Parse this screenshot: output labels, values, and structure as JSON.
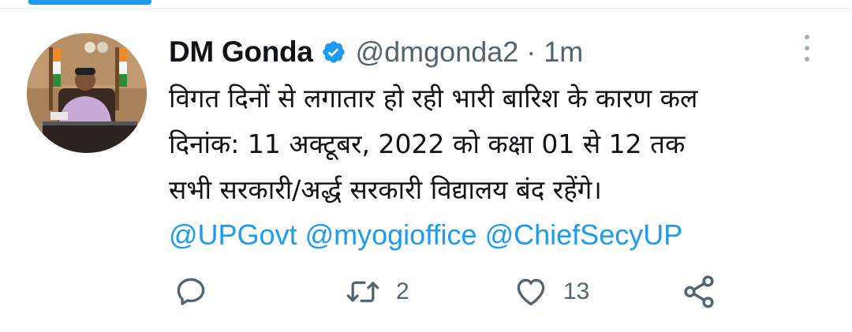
{
  "tweet": {
    "author": {
      "display_name": "DM Gonda",
      "handle": "@dmgonda2",
      "verified": true
    },
    "separator": "·",
    "time": "1m",
    "text_lines": [
      "विगत दिनों से लगातार हो रही भारी बारिश के कारण कल",
      "दिनांक: 11 अक्टूबर, 2022 को कक्षा 01 से 12 तक",
      "सभी सरकारी/अर्द्ध सरकारी विद्यालय बंद रहेंगे।"
    ],
    "mentions": [
      "@UPGovt",
      "@myogioffice",
      "@ChiefSecyUP"
    ],
    "actions": {
      "reply": {
        "icon": "reply-icon",
        "count": ""
      },
      "retweet": {
        "icon": "retweet-icon",
        "count": "2"
      },
      "like": {
        "icon": "heart-icon",
        "count": "13"
      },
      "share": {
        "icon": "share-icon",
        "count": ""
      }
    }
  },
  "colors": {
    "link": "#1d9bf0",
    "text": "#0f1419",
    "secondary": "#536471",
    "verified": "#1d9bf0"
  }
}
